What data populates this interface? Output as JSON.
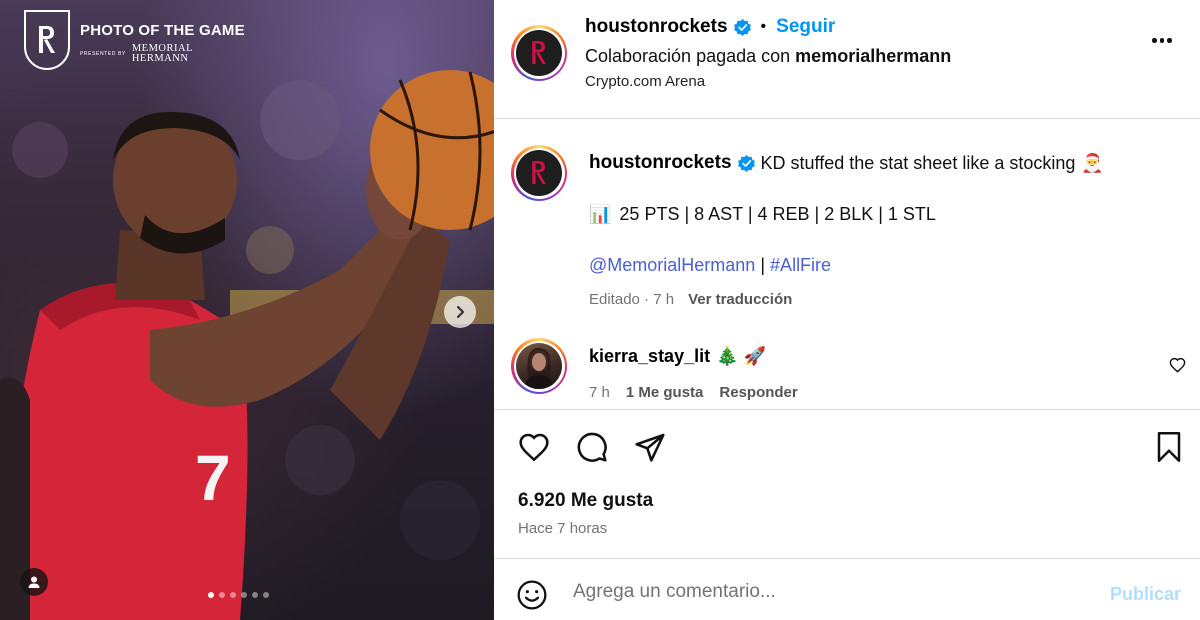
{
  "photo": {
    "title": "PHOTO OF THE GAME",
    "presented_by": "PRESENTED BY",
    "sponsor_line1": "MEMORIAL",
    "sponsor_line2": "HERMANN",
    "jersey_number": "7",
    "carousel_count": 6,
    "carousel_active": 1
  },
  "header": {
    "username": "houstonrockets",
    "separator": "•",
    "follow_label": "Seguir",
    "collab_prefix": "Colaboración pagada con",
    "collab_partner": "memorialhermann",
    "location": "Crypto.com Arena"
  },
  "caption": {
    "username": "houstonrockets",
    "text": "KD stuffed the stat sheet like a stocking",
    "santa_emoji": "🎅",
    "stats_emoji": "📊",
    "stats": "25 PTS | 8 AST | 4 REB | 2 BLK | 1 STL",
    "mention": "@MemorialHermann",
    "link_separator": "|",
    "hashtag": "#AllFire",
    "edited": "Editado · 7 h",
    "translate": "Ver traducción"
  },
  "comment": {
    "username": "kierra_stay_lit",
    "text": "🎄 🚀",
    "time": "7 h",
    "likes": "1 Me gusta",
    "reply": "Responder"
  },
  "post": {
    "likes": "6.920 Me gusta",
    "time": "Hace 7 horas"
  },
  "comment_box": {
    "placeholder": "Agrega un comentario...",
    "post_label": "Publicar"
  },
  "colors": {
    "link_blue": "#0095f6",
    "mention_blue": "#4b5fd6",
    "rockets_red": "#ce1141"
  }
}
